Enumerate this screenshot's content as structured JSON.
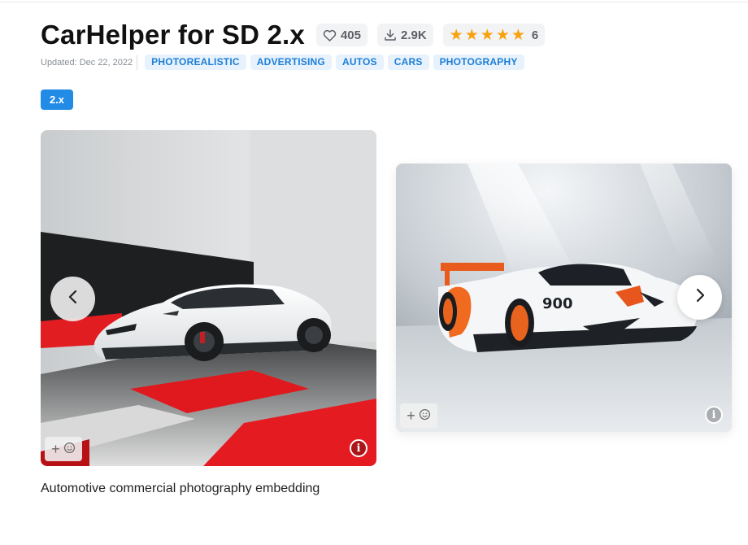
{
  "model": {
    "title": "CarHelper for SD 2.x",
    "likes": "405",
    "downloads": "2.9K",
    "rating_stars": 5,
    "rating_count": "6",
    "updated": "Updated: Dec 22, 2022",
    "tags": [
      "PHOTOREALISTIC",
      "ADVERTISING",
      "AUTOS",
      "CARS",
      "PHOTOGRAPHY"
    ],
    "version": "2.x",
    "description": "Automotive commercial photography embedding"
  },
  "icons": {
    "like": "heart-icon",
    "download": "download-icon",
    "star": "star-icon",
    "add_reaction": "add-reaction-icon",
    "info": "info-icon",
    "prev": "chevron-left-icon",
    "next": "chevron-right-icon"
  },
  "gallery": [
    {
      "alt": "White electric sports sedan in studio with red floor stripes"
    },
    {
      "alt": "White race car with orange accents and rear wing in studio"
    }
  ],
  "colors": {
    "accent": "#228be6",
    "tag_bg": "#e7f2fd",
    "tag_text": "#1c7ed6",
    "star": "#f7a20e"
  }
}
